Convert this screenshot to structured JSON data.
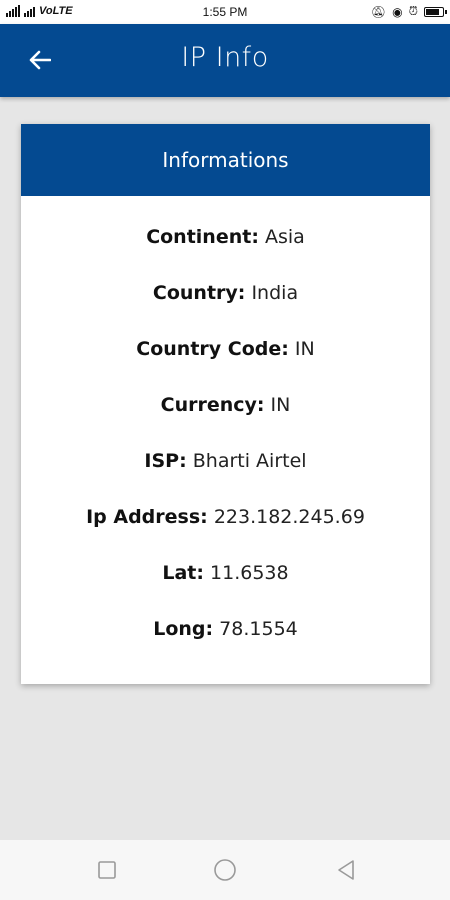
{
  "status_bar": {
    "network": "VoLTE",
    "time": "1:55 PM"
  },
  "app_bar": {
    "title": "IP Info",
    "back_icon": "arrow-left-icon"
  },
  "card": {
    "header": "Informations",
    "rows": [
      {
        "label": "Continent:",
        "value": "Asia"
      },
      {
        "label": "Country:",
        "value": "India"
      },
      {
        "label": "Country Code:",
        "value": "IN"
      },
      {
        "label": "Currency:",
        "value": "IN"
      },
      {
        "label": "ISP:",
        "value": "Bharti Airtel"
      },
      {
        "label": "Ip Address:",
        "value": "223.182.245.69"
      },
      {
        "label": "Lat:",
        "value": "11.6538"
      },
      {
        "label": "Long:",
        "value": "78.1554"
      }
    ]
  },
  "nav_bar": {
    "icons": [
      "recent-apps-icon",
      "home-icon",
      "back-triangle-icon"
    ]
  },
  "colors": {
    "primary": "#044a91",
    "background": "#e6e6e6",
    "card": "#ffffff"
  }
}
